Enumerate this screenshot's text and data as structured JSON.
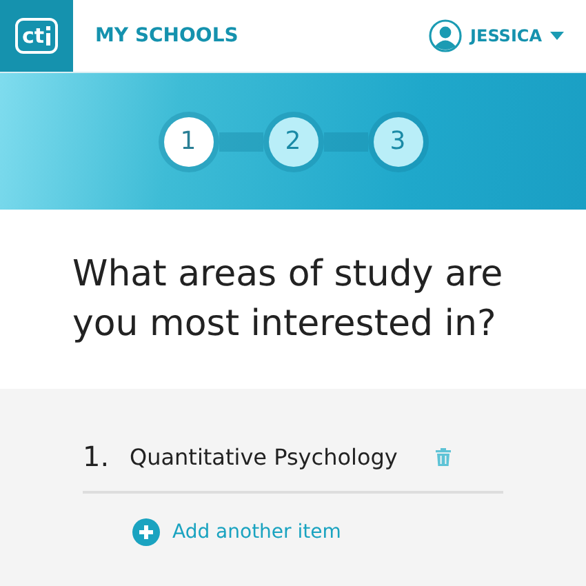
{
  "header": {
    "logo": "ct",
    "title": "MY SCHOOLS",
    "user": "JESSICA"
  },
  "steps": [
    {
      "label": "1",
      "selected": true
    },
    {
      "label": "2",
      "selected": false
    },
    {
      "label": "3",
      "selected": false
    }
  ],
  "question": "What areas of study are you most interested in?",
  "items": [
    {
      "number": "1.",
      "text": "Quantitative Psychology"
    }
  ],
  "add_button": "Add another item"
}
